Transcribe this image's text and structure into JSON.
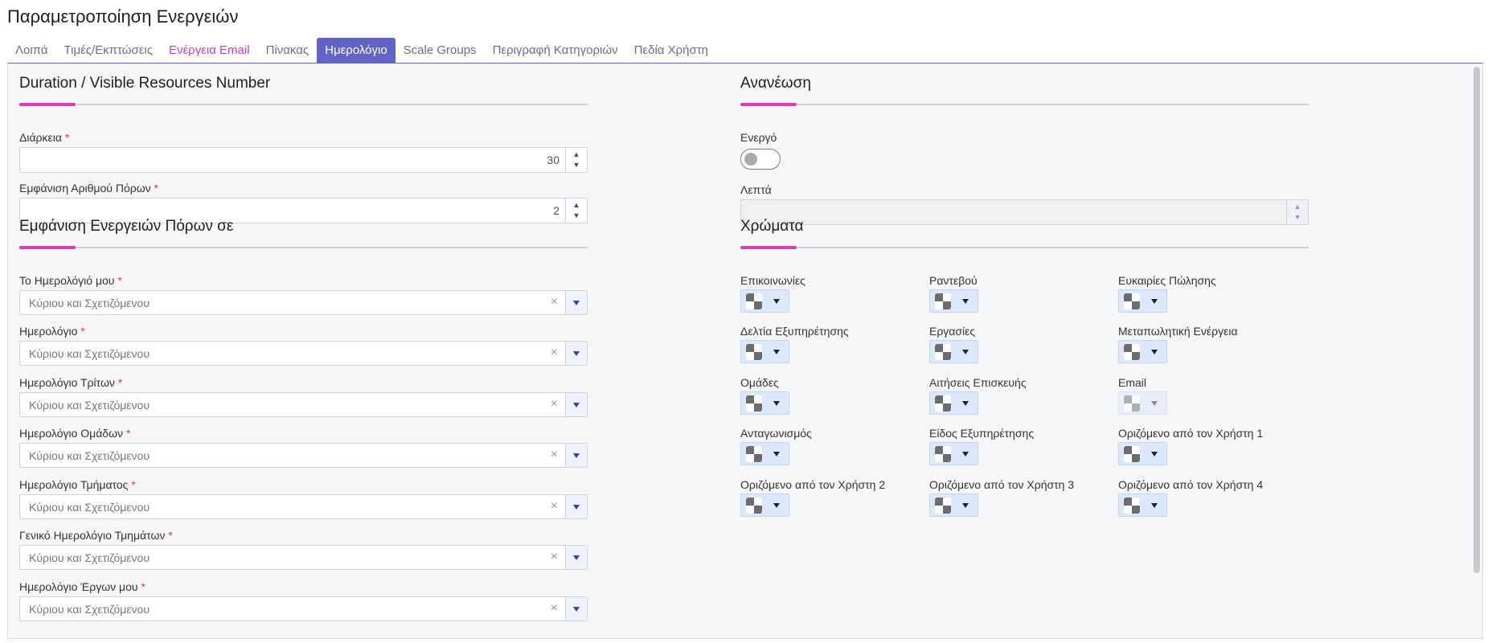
{
  "page": {
    "title": "Παραμετροποίηση Ενεργειών"
  },
  "tabs": [
    {
      "label": "Λοιπά"
    },
    {
      "label": "Τιμές/Εκπτώσεις"
    },
    {
      "label": "Ενέργεια Email"
    },
    {
      "label": "Πίνακας"
    },
    {
      "label": "Ημερολόγιο"
    },
    {
      "label": "Scale Groups"
    },
    {
      "label": "Περιγραφή Κατηγοριών"
    },
    {
      "label": "Πεδία Χρήστη"
    }
  ],
  "active_tab": "Ημερολόγιο",
  "duration": {
    "title": "Duration / Visible Resources Number",
    "duration_label": "Διάρκεια",
    "duration_value": "30",
    "resources_label": "Εμφάνιση Αριθμού Πόρων",
    "resources_value": "2"
  },
  "refresh": {
    "title": "Ανανέωση",
    "active_label": "Ενεργό",
    "active_value": false,
    "minutes_label": "Λεπτά",
    "minutes_value": ""
  },
  "display": {
    "title": "Εμφάνιση Ενεργειών Πόρων σε",
    "placeholder": "Κύριου και Σχετιζόμενου",
    "fields": [
      {
        "label": "Το Ημερολόγιό μου"
      },
      {
        "label": "Ημερολόγιο"
      },
      {
        "label": "Ημερολόγιο Τρίτων"
      },
      {
        "label": "Ημερολόγιο Ομάδων"
      },
      {
        "label": "Ημερολόγιο Τμήματος"
      },
      {
        "label": "Γενικό Ημερολόγιο Τμημάτων"
      },
      {
        "label": "Ημερολόγιο Έργων μου"
      }
    ]
  },
  "colors": {
    "title": "Χρώματα",
    "items": [
      {
        "label": "Επικοινωνίες",
        "disabled": false
      },
      {
        "label": "Ραντεβού",
        "disabled": false
      },
      {
        "label": "Ευκαιρίες Πώλησης",
        "disabled": false
      },
      {
        "label": "Δελτία Εξυπηρέτησης",
        "disabled": false
      },
      {
        "label": "Εργασίες",
        "disabled": false
      },
      {
        "label": "Μεταπωλητική Ενέργεια",
        "disabled": false
      },
      {
        "label": "Ομάδες",
        "disabled": false
      },
      {
        "label": "Αιτήσεις Επισκευής",
        "disabled": false
      },
      {
        "label": "Email",
        "disabled": true
      },
      {
        "label": "Ανταγωνισμός",
        "disabled": false
      },
      {
        "label": "Είδος Εξυπηρέτησης",
        "disabled": false
      },
      {
        "label": "Οριζόμενο από τον Χρήστη 1",
        "disabled": false
      },
      {
        "label": "Οριζόμενο από τον Χρήστη 2",
        "disabled": false
      },
      {
        "label": "Οριζόμενο από τον Χρήστη 3",
        "disabled": false
      },
      {
        "label": "Οριζόμενο από τον Χρήστη 4",
        "disabled": false
      }
    ]
  },
  "theme": {
    "accent": "#6164c6",
    "highlight": "#d63fb8",
    "required": "#e0383e"
  }
}
